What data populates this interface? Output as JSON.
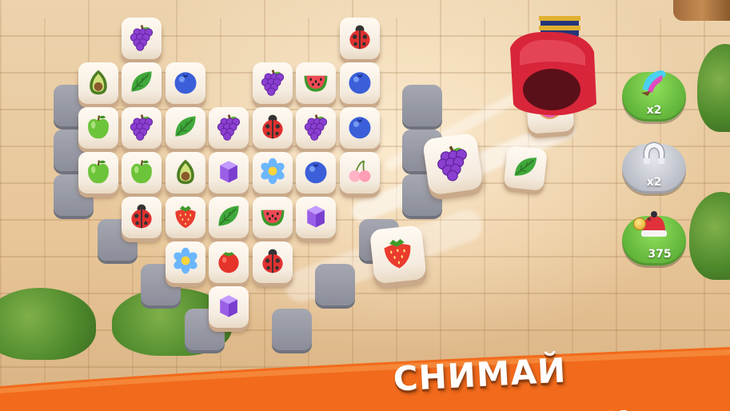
{
  "banner": {
    "text": "СНИМАЙ НАПРЯЖЕНИЕ!",
    "color": "#f26a1b"
  },
  "boosters": [
    {
      "name": "shuffle",
      "icon": "rainbow-brush-icon",
      "count": "x2",
      "color": "#5fb53a"
    },
    {
      "name": "undo",
      "icon": "magnet-icon",
      "count": "x2",
      "color": "#b9bcc4"
    },
    {
      "name": "hint",
      "icon": "red-beanie-hat-icon",
      "count": "375",
      "color": "#5fb53a",
      "currency_icon": "coin-icon"
    }
  ],
  "board": {
    "shape": "heart",
    "tiles": [
      [
        "",
        "",
        "grapes",
        "",
        "",
        "",
        "",
        "ladybug",
        "",
        ""
      ],
      [
        "",
        "avocado",
        "leaf",
        "blueberry",
        "",
        "grapes",
        "watermelon",
        "blueberry",
        "",
        ""
      ],
      [
        "",
        "apple",
        "grapes",
        "leaf",
        "grapes",
        "ladybug",
        "grapes",
        "blueberry",
        "",
        ""
      ],
      [
        "",
        "apple",
        "apple",
        "avocado",
        "cube",
        "flower",
        "blueberry",
        "cherry",
        "",
        ""
      ],
      [
        "",
        "",
        "ladybug",
        "strawberry",
        "leaf",
        "watermelon",
        "cube",
        "",
        "",
        ""
      ],
      [
        "",
        "",
        "",
        "flower",
        "tomato",
        "ladybug",
        "",
        "",
        "",
        ""
      ],
      [
        "",
        "",
        "",
        "",
        "cube",
        "",
        "",
        "",
        "",
        ""
      ]
    ]
  },
  "flying_tiles": [
    "grapes",
    "leaf",
    "strawberry",
    "donut"
  ],
  "dispenser": {
    "icon": "red-vacuum-tube-icon",
    "color": "#d8253a"
  }
}
